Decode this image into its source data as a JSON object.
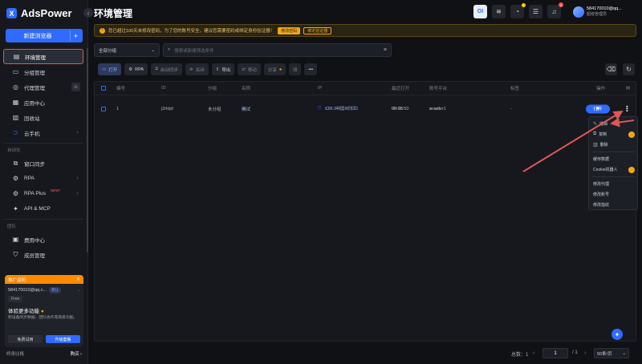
{
  "app": {
    "name": "AdsPower",
    "logo_letter": "X"
  },
  "sidebar": {
    "new_browser": "新建浏览器",
    "items": [
      {
        "label": "环境管理",
        "icon": "list-icon"
      },
      {
        "label": "分组管理",
        "icon": "folder-icon"
      },
      {
        "label": "代理管理",
        "icon": "globe-icon"
      },
      {
        "label": "应用中心",
        "icon": "grid-icon"
      },
      {
        "label": "回收站",
        "icon": "trash-icon"
      },
      {
        "label": "云手机",
        "icon": "phone-icon"
      }
    ],
    "auto_title": "自动化",
    "auto_items": [
      {
        "label": "窗口同步",
        "icon": "sync-icon"
      },
      {
        "label": "RPA",
        "icon": "robot-icon"
      },
      {
        "label": "RPA Plus",
        "icon": "robot-plus-icon",
        "badge": "NEW!"
      },
      {
        "label": "API & MCP",
        "icon": "api-icon"
      }
    ],
    "team_title": "团队",
    "team_items": [
      {
        "label": "费用中心",
        "icon": "wallet-icon"
      },
      {
        "label": "成员管理",
        "icon": "shield-icon"
      }
    ]
  },
  "promo": {
    "head": "推广返利",
    "account": "584170010@qq.c...",
    "account_badge": "默认",
    "plan": "Free",
    "title": "体验更多功能",
    "desc": "跨设备同步数据、团队协作等高级功能。",
    "btn_trial": "免费试用",
    "btn_upgrade": "升级套餐"
  },
  "footer": {
    "left": "终身比格",
    "right": "购买"
  },
  "header": {
    "title": "环境管理",
    "brand_btn": "OI",
    "user_email": "584170010@qq...",
    "user_role": "超级管理员",
    "notif_count": "2"
  },
  "notice": {
    "text": "您已超过100天未修改密码，为了您的账号安全，建议您需要密码或绑定身份验证器！",
    "btn1": "修改密码",
    "btn2": "绑定验证器"
  },
  "filter": {
    "group": "全部分组",
    "search_placeholder": "搜索或新建筛选条件"
  },
  "toolbar": {
    "open": "打开",
    "rpa": "RPA",
    "start_sync": "启动同步",
    "close": "关闭",
    "export": "导出",
    "move": "移动",
    "share": "分享"
  },
  "table": {
    "headers": {
      "no": "编号",
      "id": "ID",
      "group": "分组",
      "name": "名称",
      "ip": "IP",
      "last_open": "最近打开",
      "platform": "账号平台",
      "tags": "标签",
      "action": "操作"
    },
    "rows": [
      {
        "no": "1",
        "id": "j2rktjd",
        "group": "未分组",
        "name": "测试",
        "ip": "123.149.100.113",
        "ip_loc": "CN - 中国 / 丹江",
        "date": "06-16",
        "time": "00:05:50",
        "platform": "user1",
        "platform_sub": "user1",
        "tags": "-",
        "action": "打开"
      }
    ]
  },
  "menu": {
    "items": [
      "编辑",
      "复制",
      "删除",
      "缓存数据",
      "Cookie机器人",
      "修改代理",
      "修改账号",
      "修改指纹"
    ]
  },
  "pager": {
    "total": "总数：1",
    "page": "1",
    "of": "/ 1",
    "size": "50条/页"
  },
  "colors": {
    "accent": "#2f6bff",
    "annotation": "#e05656",
    "warning": "#f3a712"
  }
}
